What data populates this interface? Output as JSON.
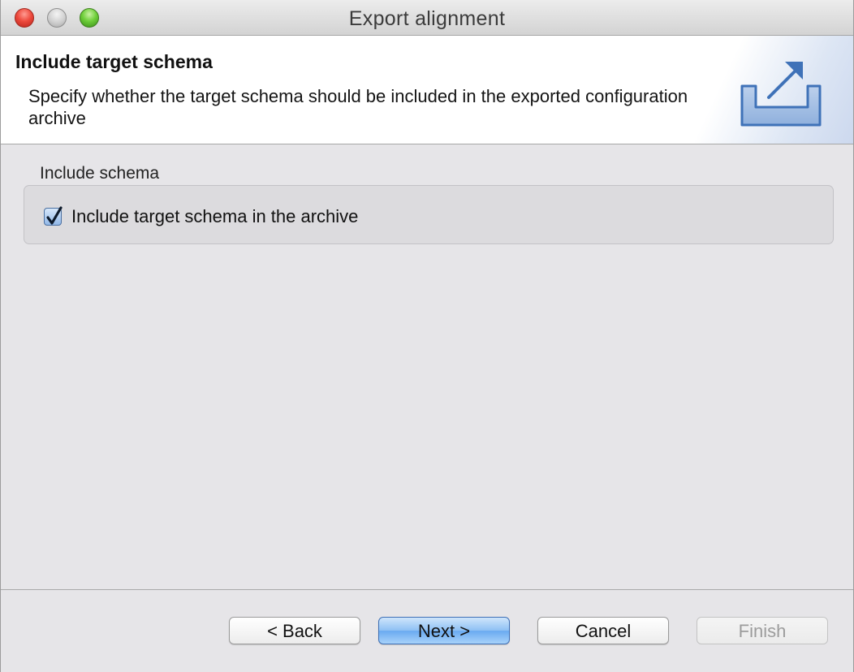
{
  "window": {
    "title": "Export alignment"
  },
  "header": {
    "title": "Include target schema",
    "description": "Specify whether the target schema should be included in the exported configuration archive",
    "icon": "export-icon"
  },
  "group": {
    "label": "Include schema",
    "checkbox": {
      "label": "Include target schema in the archive",
      "checked": true
    }
  },
  "buttons": {
    "back": "< Back",
    "next": "Next >",
    "cancel": "Cancel",
    "finish": "Finish"
  },
  "colors": {
    "accent": "#6aaaf0",
    "icon": "#3f72b8"
  }
}
